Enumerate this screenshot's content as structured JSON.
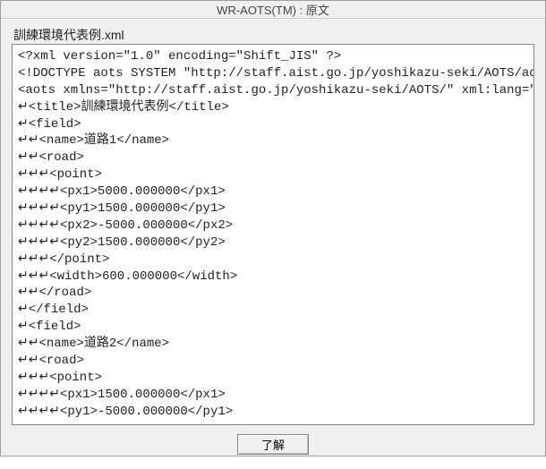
{
  "window": {
    "title": "WR-AOTS(TM) : 原文"
  },
  "filename": "訓練環境代表例.xml",
  "content_lines": [
    "<?xml version=\"1.0\" encoding=\"Shift_JIS\" ?>",
    "<!DOCTYPE aots SYSTEM \"http://staff.aist.go.jp/yoshikazu-seki/AOTS/aots.dtd\">",
    "<aots xmlns=\"http://staff.aist.go.jp/yoshikazu-seki/AOTS/\" xml:lang=\"ja\">",
    "↵<title>訓練環境代表例</title>",
    "↵<field>",
    "↵↵<name>道路1</name>",
    "↵↵<road>",
    "↵↵↵<point>",
    "↵↵↵↵<px1>5000.000000</px1>",
    "↵↵↵↵<py1>1500.000000</py1>",
    "↵↵↵↵<px2>-5000.000000</px2>",
    "↵↵↵↵<py2>1500.000000</py2>",
    "↵↵↵</point>",
    "↵↵↵<width>600.000000</width>",
    "↵↵</road>",
    "↵</field>",
    "↵<field>",
    "↵↵<name>道路2</name>",
    "↵↵<road>",
    "↵↵↵<point>",
    "↵↵↵↵<px1>1500.000000</px1>",
    "↵↵↵↵<py1>-5000.000000</py1>"
  ],
  "buttons": {
    "ok_label": "了解"
  }
}
